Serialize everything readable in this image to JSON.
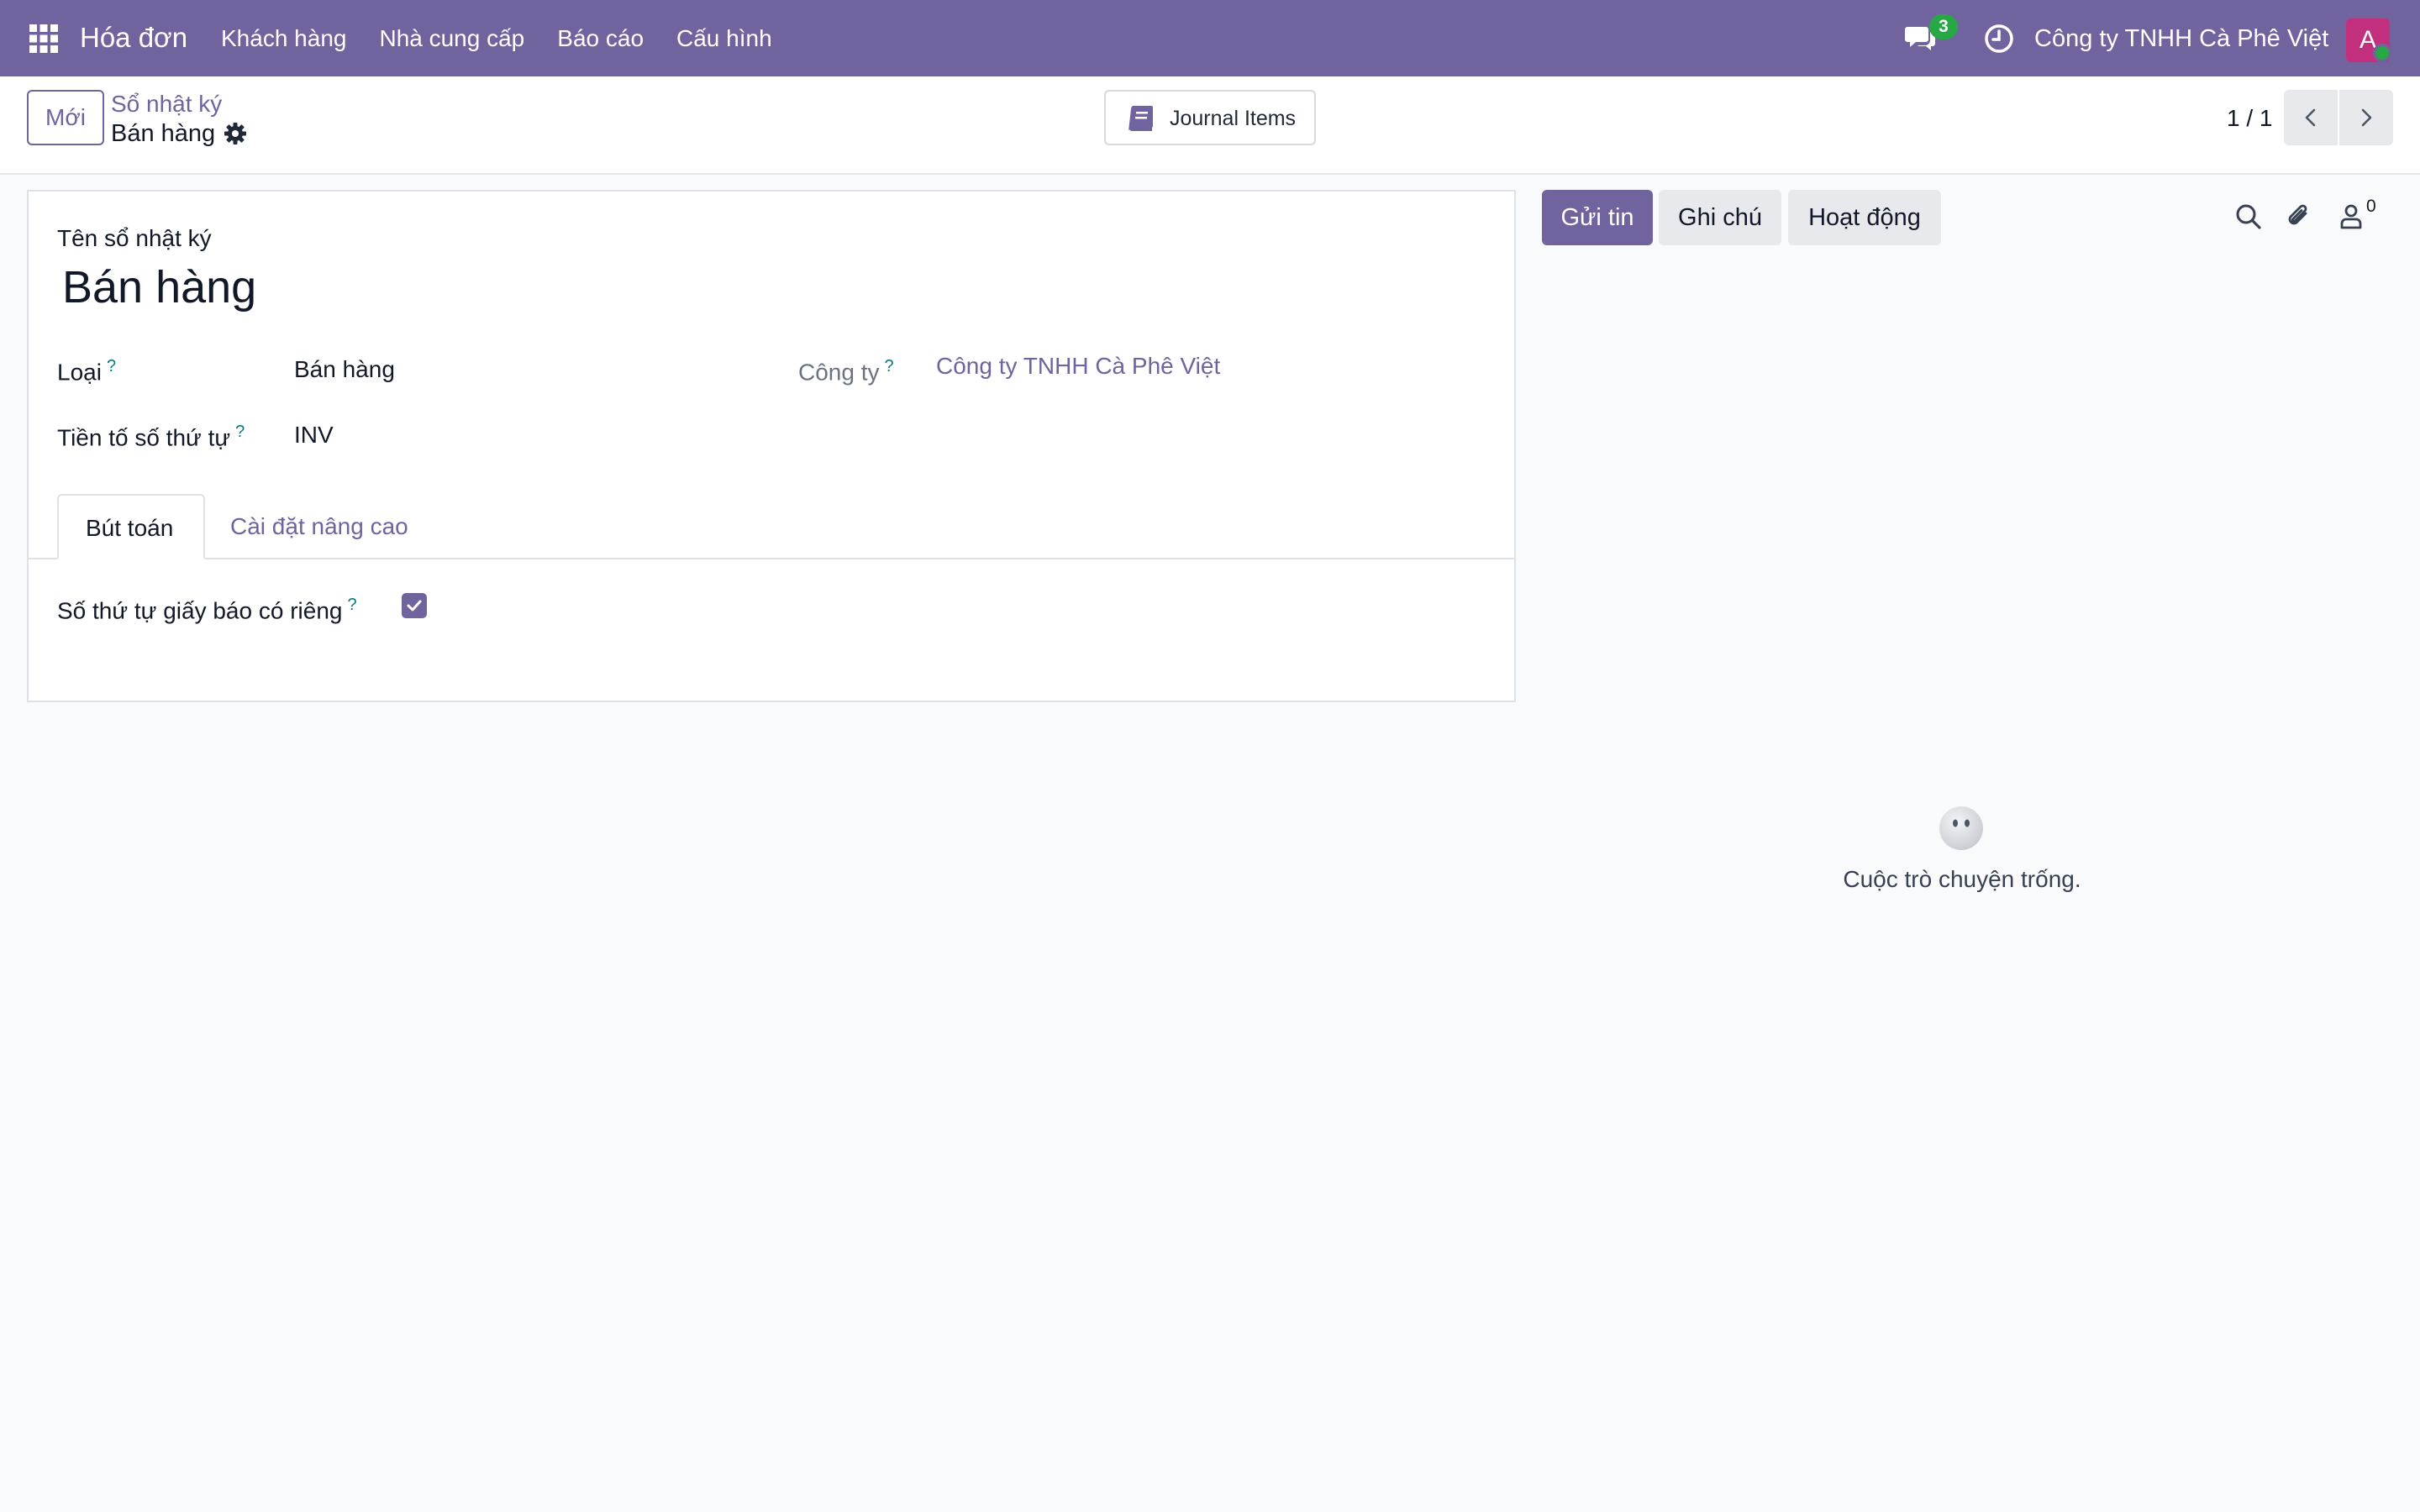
{
  "navbar": {
    "app_name": "Hóa đơn",
    "menu": [
      "Khách hàng",
      "Nhà cung cấp",
      "Báo cáo",
      "Cấu hình"
    ],
    "message_count": "3",
    "company": "Công ty TNHH Cà Phê Việt",
    "avatar_initial": "A",
    "icons": [
      "apps-grid-icon",
      "chat-icon",
      "clock-icon"
    ]
  },
  "control_panel": {
    "new_label": "Mới",
    "breadcrumb_parent": "Sổ nhật ký",
    "breadcrumb_current": "Bán hàng",
    "smart_button_label": "Journal Items",
    "pager_value": "1 / 1"
  },
  "form": {
    "name_label": "Tên sổ nhật ký",
    "name_value": "Bán hàng",
    "type_label": "Loại",
    "type_value": "Bán hàng",
    "company_label": "Công ty",
    "company_value": "Công ty TNHH Cà Phê Việt",
    "prefix_label": "Tiền tố số thứ tự",
    "prefix_value": "INV",
    "help_mark": "?",
    "tabs": [
      "Bút toán",
      "Cài đặt nâng cao"
    ],
    "refund_sequence_label": "Số thứ tự giấy báo có riêng",
    "refund_sequence_checked": true
  },
  "chatter": {
    "send_label": "Gửi tin",
    "note_label": "Ghi chú",
    "activity_label": "Hoạt động",
    "follower_count": "0",
    "empty_text": "Cuộc trò chuyện trống."
  },
  "colors": {
    "brand": "#71639e",
    "badge": "#28a745",
    "avatar": "#c2307d",
    "help": "#017e84"
  }
}
